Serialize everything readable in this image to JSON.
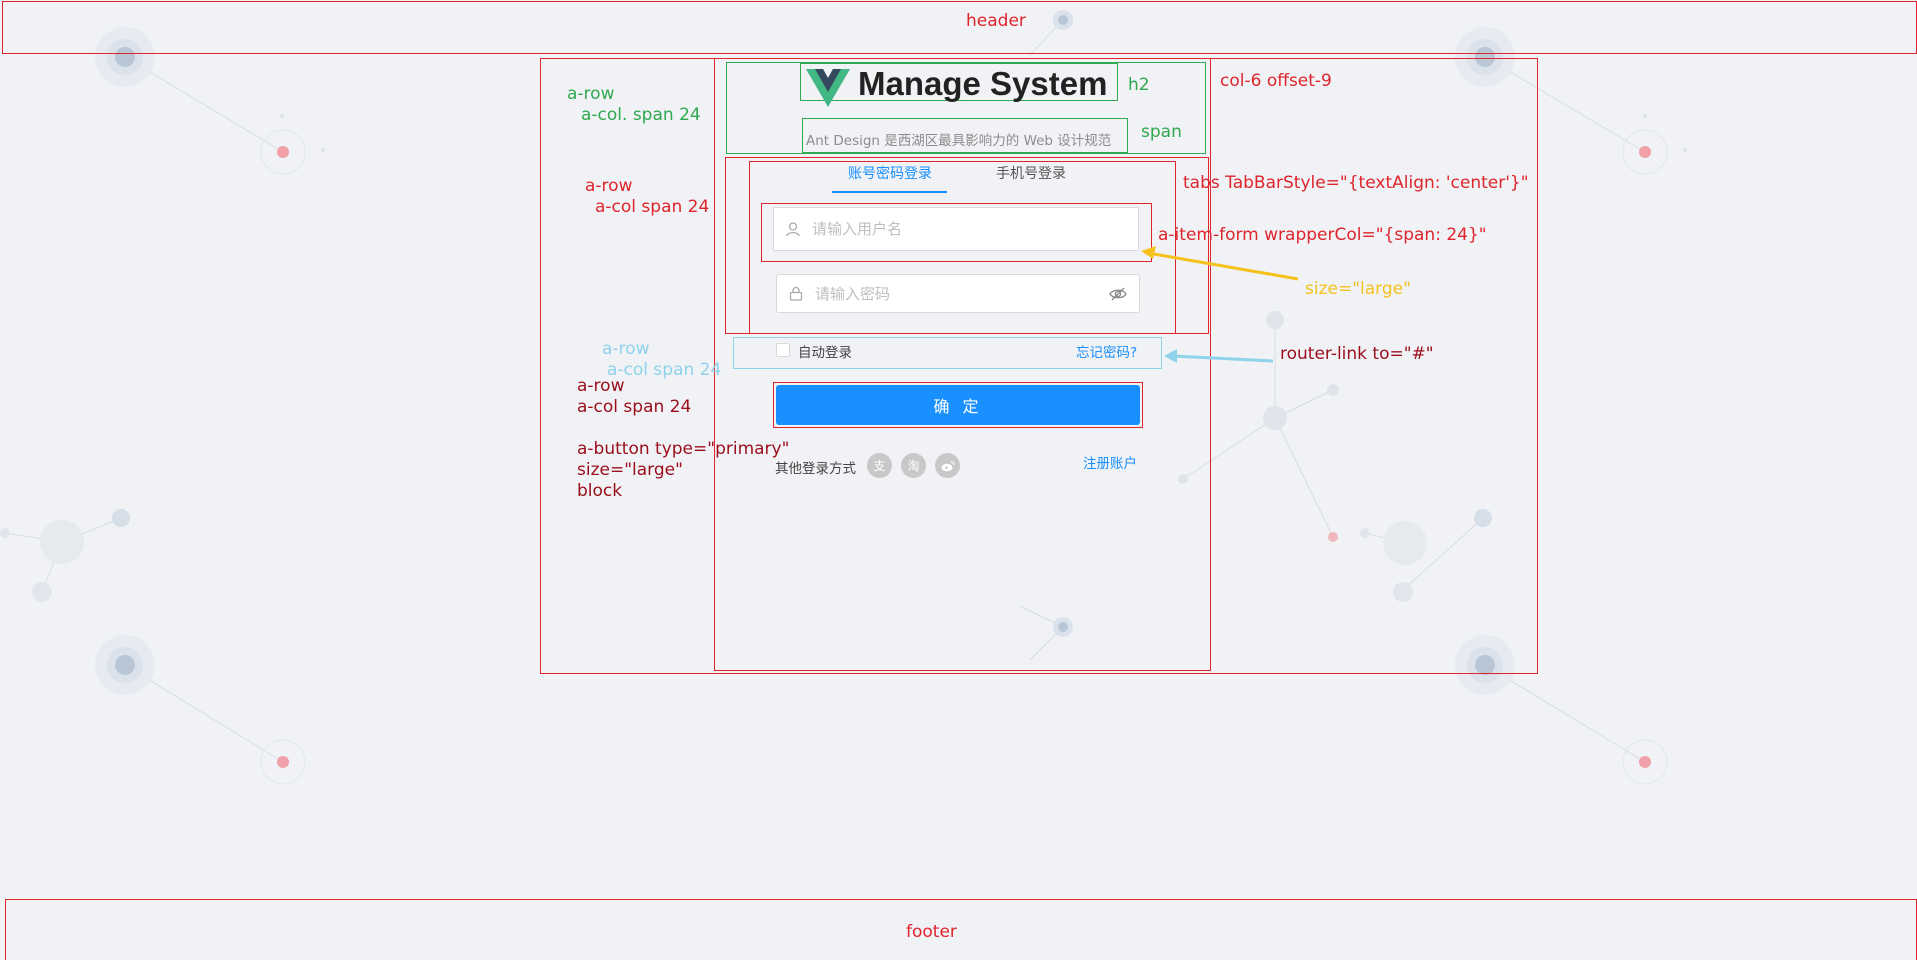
{
  "header": {
    "label": "header"
  },
  "footer": {
    "label": "footer"
  },
  "brand": {
    "title": "Manage System",
    "subtitle": "Ant Design 是西湖区最具影响力的 Web 设计规范",
    "logo_icon": "vue-logo-icon"
  },
  "tabs": [
    {
      "label": "账号密码登录",
      "active": true
    },
    {
      "label": "手机号登录",
      "active": false
    }
  ],
  "form": {
    "username_placeholder": "请输入用户名",
    "password_placeholder": "请输入密码",
    "remember_label": "自动登录",
    "forgot_link": "忘记密码?",
    "submit_label": "确 定",
    "other_login_label": "其他登录方式",
    "social_icons": [
      "alipay-icon",
      "taobao-icon",
      "weibo-icon"
    ],
    "register_link": "注册账户"
  },
  "annotations": {
    "row1": "a-row",
    "col1": "a-col. span 24",
    "h2": "h2",
    "span": "span",
    "col_offset": "col-6  offset-9",
    "row2": "a-row",
    "col2": "a-col span 24",
    "tabs": "tabs TabBarStyle=\"{textAlign: 'center'}\"",
    "item_form": "a-item-form  wrapperCol=\"{span: 24}\"",
    "size_large": "size=\"large\"",
    "row3": "a-row",
    "col3": "a-col span 24",
    "router_link": "router-link to=\"#\"",
    "row4": "a-row",
    "col4": "a-col span 24",
    "button_line1": "a-button type=\"primary\"",
    "button_line2": "size=\"large\"",
    "button_line3": "block"
  },
  "colors": {
    "annotation_red": "#e0242b",
    "annotation_green": "#2fa84f",
    "annotation_yellow": "#f5c11b",
    "annotation_lightblue": "#8fd3ea",
    "annotation_dark": "#9b0d1a",
    "primary": "#1890ff",
    "background": "#f0f2f5"
  }
}
